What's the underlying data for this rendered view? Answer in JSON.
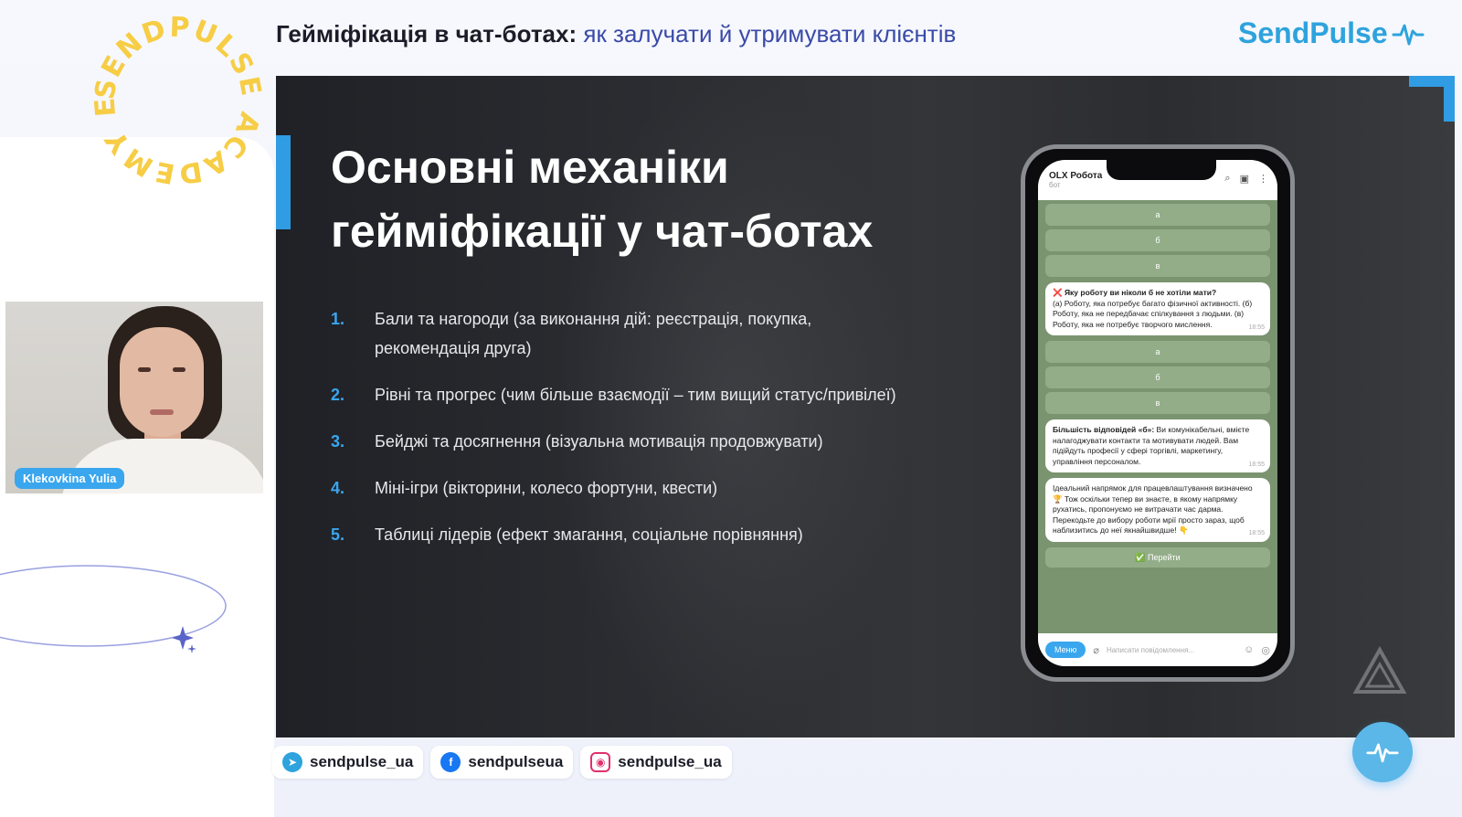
{
  "header": {
    "title_main": "Гейміфікація в чат-ботах:",
    "title_accent": "як залучати й утримувати клієнтів"
  },
  "brand": {
    "name": "SendPulse",
    "color": "#2ea3dd"
  },
  "badge": {
    "text": "SENDPULSE ACADEMY EVENT",
    "color": "#f6cd45"
  },
  "slide": {
    "title_line1": "Основні механіки",
    "title_line2": "гейміфікації у чат-ботах",
    "items": [
      {
        "num": "1.",
        "text": "Бали та нагороди (за виконання дій: реєстрація, покупка, рекомендація друга)"
      },
      {
        "num": "2.",
        "text": "Рівні та прогрес (чим більше взаємодії – тим вищий статус/привілеї)"
      },
      {
        "num": "3.",
        "text": "Бейджі та досягнення (візуальна мотивація продовжувати)"
      },
      {
        "num": "4.",
        "text": "Міні-ігри (вікторини, колесо фортуни, квести)"
      },
      {
        "num": "5.",
        "text": "Таблиці лідерів (ефект змагання, соціальне порівняння)"
      }
    ],
    "accent_color": "#2f9ce3"
  },
  "phone": {
    "chat_name": "OLX Робота",
    "chat_sub": "бот",
    "options_top": [
      "а",
      "б",
      "в"
    ],
    "question": "❌ Яку роботу ви ніколи б не хотіли мати?",
    "question_body": "(а) Роботу, яка потребує багато фізичної активності. (б) Роботу, яка не передбачає спілкування з людьми. (в) Роботу, яка не потребує творчого мислення.",
    "time1": "18:55",
    "options_mid": [
      "а",
      "б",
      "в"
    ],
    "result_title": "Більшість відповідей «б»:",
    "result_body": "Ви комунікабельні, вмієте налагоджувати контакти та мотивувати людей. Вам підійдуть професії у сфері торгівлі, маркетингу, управління персоналом.",
    "time2": "18:55",
    "final_msg": "Ідеальний напрямок для працевлаштування визначено 🏆 Тож оскільки тепер ви знаєте, в якому напрямку рухатись, пропонуємо не витрачати час дарма. Перекодьте до вибору роботи мрії просто зараз, щоб наблизитись до неї якнайшвидше! 👇",
    "time3": "18:55",
    "go_button": "✅ Перейти",
    "menu_button": "Меню",
    "input_placeholder": "Написати повідомлення..."
  },
  "webcam": {
    "name": "Klekovkina Yulia"
  },
  "socials": [
    {
      "icon": "telegram-icon",
      "label": "sendpulse_ua"
    },
    {
      "icon": "facebook-icon",
      "label": "sendpulseua"
    },
    {
      "icon": "instagram-icon",
      "label": "sendpulse_ua"
    }
  ]
}
